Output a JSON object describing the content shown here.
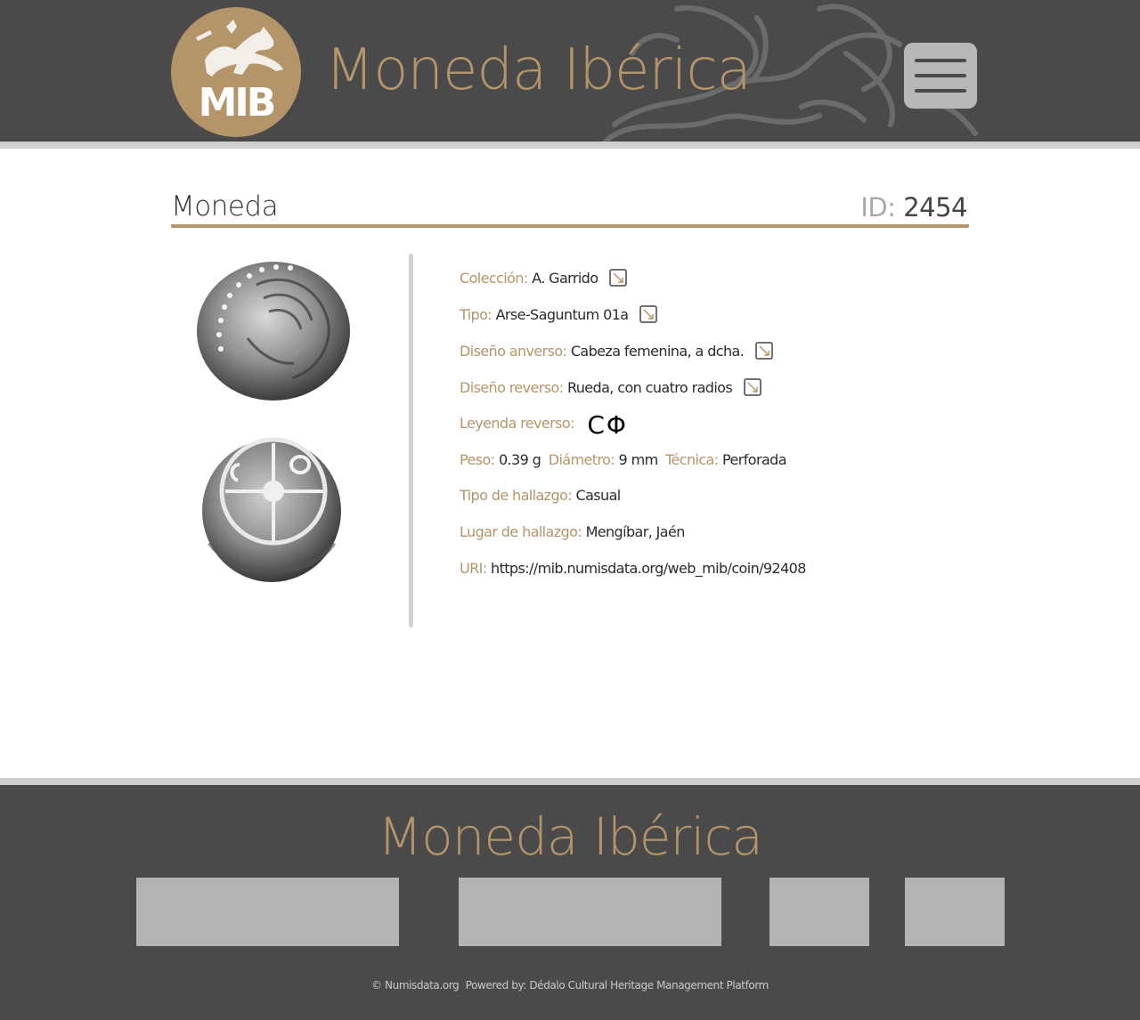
{
  "header": {
    "logo_text": "MIB",
    "site_title": "Moneda Ibérica",
    "menu_icon": "hamburger-menu-icon"
  },
  "main": {
    "page_title": "Moneda",
    "id_label": "ID:",
    "id_value": "2454",
    "images": {
      "obverse_icon": "coin-obverse-photo",
      "reverse_icon": "coin-reverse-photo"
    },
    "fields": {
      "coleccion": {
        "label": "Colección:",
        "value": "A. Garrido"
      },
      "tipo": {
        "label": "Tipo:",
        "value": "Arse-Saguntum 01a"
      },
      "diseno_anverso": {
        "label": "Diseño anverso:",
        "value": "Cabeza femenina, a dcha."
      },
      "diseno_reverso": {
        "label": "Diseño reverso:",
        "value": "Rueda, con cuatro radios"
      },
      "leyenda_reverso": {
        "label": "Leyenda reverso:",
        "value": "ϹΦ"
      },
      "peso": {
        "label": "Peso:",
        "value": "0.39 g"
      },
      "diametro": {
        "label": "Diámetro:",
        "value": "9 mm"
      },
      "tecnica": {
        "label": "Técnica:",
        "value": "Perforada"
      },
      "tipo_hallazgo": {
        "label": "Tipo de hallazgo:",
        "value": "Casual"
      },
      "lugar_hallazgo": {
        "label": "Lugar de hallazgo:",
        "value": "Mengíbar, Jaén"
      },
      "uri": {
        "label": "URI:",
        "value": "https://mib.numisdata.org/web_mib/coin/92408"
      }
    },
    "link_icon": "external-link-icon"
  },
  "footer": {
    "title": "Moneda Ibérica",
    "copyright": "© Numisdata.org",
    "powered_by": "Powered by: Dédalo Cultural Heritage Management Platform"
  },
  "colors": {
    "header_bg": "#4a4a4a",
    "accent": "#b49569",
    "divider": "#d2d2d2",
    "footer_box": "#b3b3b3"
  }
}
